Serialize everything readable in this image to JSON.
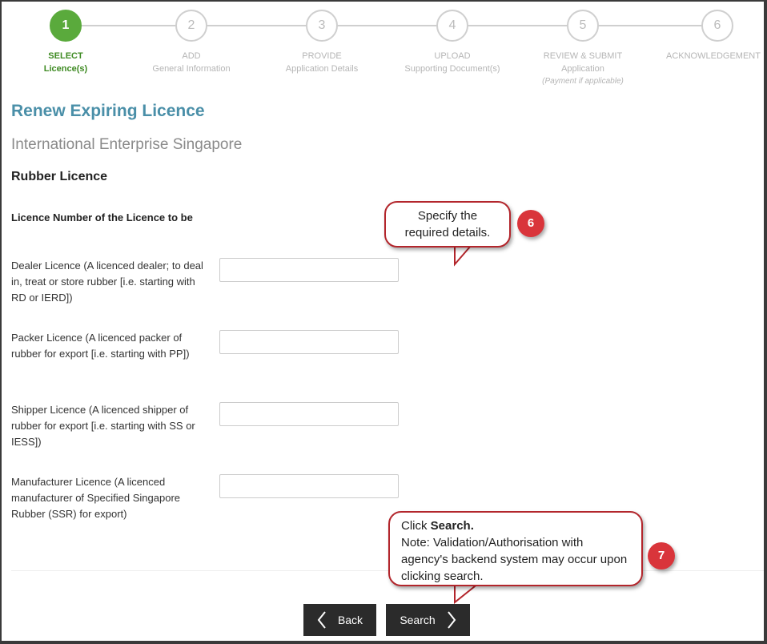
{
  "stepper": {
    "steps": [
      {
        "num": "1",
        "title": "SELECT",
        "subtitle": "Licence(s)",
        "note": ""
      },
      {
        "num": "2",
        "title": "ADD",
        "subtitle": "General Information",
        "note": ""
      },
      {
        "num": "3",
        "title": "PROVIDE",
        "subtitle": "Application Details",
        "note": ""
      },
      {
        "num": "4",
        "title": "UPLOAD",
        "subtitle": "Supporting Document(s)",
        "note": ""
      },
      {
        "num": "5",
        "title": "REVIEW & SUBMIT",
        "subtitle": "Application",
        "note": "(Payment if applicable)"
      },
      {
        "num": "6",
        "title": "ACKNOWLEDGEMENT",
        "subtitle": "",
        "note": ""
      }
    ],
    "active_index": 0,
    "active_color": "#5aaa3c"
  },
  "page": {
    "title": "Renew Expiring Licence",
    "agency": "International Enterprise Singapore",
    "licence_type": "Rubber Licence",
    "section_label": "Licence Number of the Licence to be"
  },
  "fields": [
    {
      "label": "Dealer Licence (A licenced dealer; to deal in, treat or store rubber [i.e. starting with RD or IERD])",
      "value": ""
    },
    {
      "label": "Packer Licence (A licenced packer of rubber for export [i.e. starting with PP])",
      "value": ""
    },
    {
      "label": "Shipper Licence (A licenced shipper of rubber for export [i.e. starting with SS or IESS])",
      "value": ""
    },
    {
      "label": "Manufacturer Licence (A licenced manufacturer of Specified Singapore Rubber (SSR) for export)",
      "value": ""
    }
  ],
  "buttons": {
    "back": "Back",
    "search": "Search",
    "back_icon": "chevron-left-icon",
    "search_icon": "chevron-right-icon"
  },
  "callouts": {
    "c6": {
      "badge": "6",
      "text": "Specify the required details."
    },
    "c7": {
      "badge": "7",
      "line1_prefix": "Click ",
      "line1_bold": "Search.",
      "note": "Note: Validation/Authorisation with agency's backend system may occur upon clicking search."
    },
    "accent_color": "#d9353b"
  }
}
